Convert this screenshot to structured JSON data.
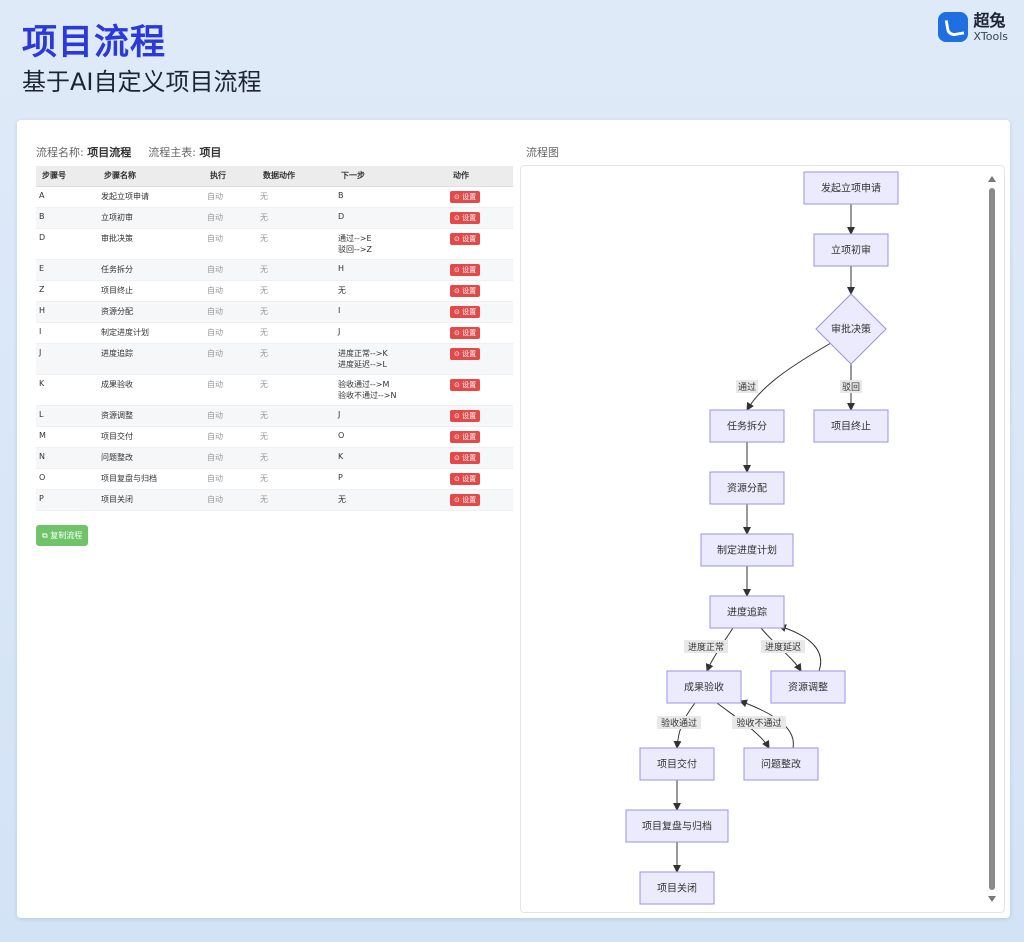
{
  "header": {
    "title": "项目流程",
    "subtitle": "基于AI自定义项目流程",
    "brand_name": "超兔",
    "brand_en": "XTools"
  },
  "info": {
    "name_label": "流程名称:",
    "name_value": "项目流程",
    "table_label": "流程主表:",
    "table_value": "项目"
  },
  "table": {
    "headers": [
      "步骤号",
      "步骤名称",
      "执行",
      "数据动作",
      "下一步",
      "动作"
    ],
    "action_label": "设置",
    "rows": [
      {
        "id": "A",
        "name": "发起立项申请",
        "exec": "自动",
        "data": "无",
        "next": [
          "B"
        ]
      },
      {
        "id": "B",
        "name": "立项初审",
        "exec": "自动",
        "data": "无",
        "next": [
          "D"
        ]
      },
      {
        "id": "D",
        "name": "审批决策",
        "exec": "自动",
        "data": "无",
        "next": [
          "通过-->E",
          "驳回-->Z"
        ]
      },
      {
        "id": "E",
        "name": "任务拆分",
        "exec": "自动",
        "data": "无",
        "next": [
          "H"
        ]
      },
      {
        "id": "Z",
        "name": "项目终止",
        "exec": "自动",
        "data": "无",
        "next": [
          "无"
        ]
      },
      {
        "id": "H",
        "name": "资源分配",
        "exec": "自动",
        "data": "无",
        "next": [
          "I"
        ]
      },
      {
        "id": "I",
        "name": "制定进度计划",
        "exec": "自动",
        "data": "无",
        "next": [
          "J"
        ]
      },
      {
        "id": "J",
        "name": "进度追踪",
        "exec": "自动",
        "data": "无",
        "next": [
          "进度正常-->K",
          "进度延迟-->L"
        ]
      },
      {
        "id": "K",
        "name": "成果验收",
        "exec": "自动",
        "data": "无",
        "next": [
          "验收通过-->M",
          "验收不通过-->N"
        ]
      },
      {
        "id": "L",
        "name": "资源调整",
        "exec": "自动",
        "data": "无",
        "next": [
          "J"
        ]
      },
      {
        "id": "M",
        "name": "项目交付",
        "exec": "自动",
        "data": "无",
        "next": [
          "O"
        ]
      },
      {
        "id": "N",
        "name": "问题整改",
        "exec": "自动",
        "data": "无",
        "next": [
          "K"
        ]
      },
      {
        "id": "O",
        "name": "项目复盘与归档",
        "exec": "自动",
        "data": "无",
        "next": [
          "P"
        ]
      },
      {
        "id": "P",
        "name": "项目关闭",
        "exec": "自动",
        "data": "无",
        "next": [
          "无"
        ]
      }
    ]
  },
  "copy_button": "复制流程",
  "flow": {
    "label": "流程图",
    "colors": {
      "node_fill": "#ecebfe",
      "node_stroke": "#9b90e6",
      "edge": "#333333",
      "edge_label_bg": "#e8e8e8"
    },
    "nodes": {
      "A": "发起立项申请",
      "B": "立项初审",
      "D": "审批决策",
      "E": "任务拆分",
      "Z": "项目终止",
      "H": "资源分配",
      "I": "制定进度计划",
      "J": "进度追踪",
      "K": "成果验收",
      "L": "资源调整",
      "M": "项目交付",
      "N": "问题整改",
      "O": "项目复盘与归档",
      "P": "项目关闭"
    },
    "edge_labels": {
      "pass": "通过",
      "reject": "驳回",
      "normal": "进度正常",
      "delay": "进度延迟",
      "accept": "验收通过",
      "refuse": "验收不通过"
    }
  }
}
